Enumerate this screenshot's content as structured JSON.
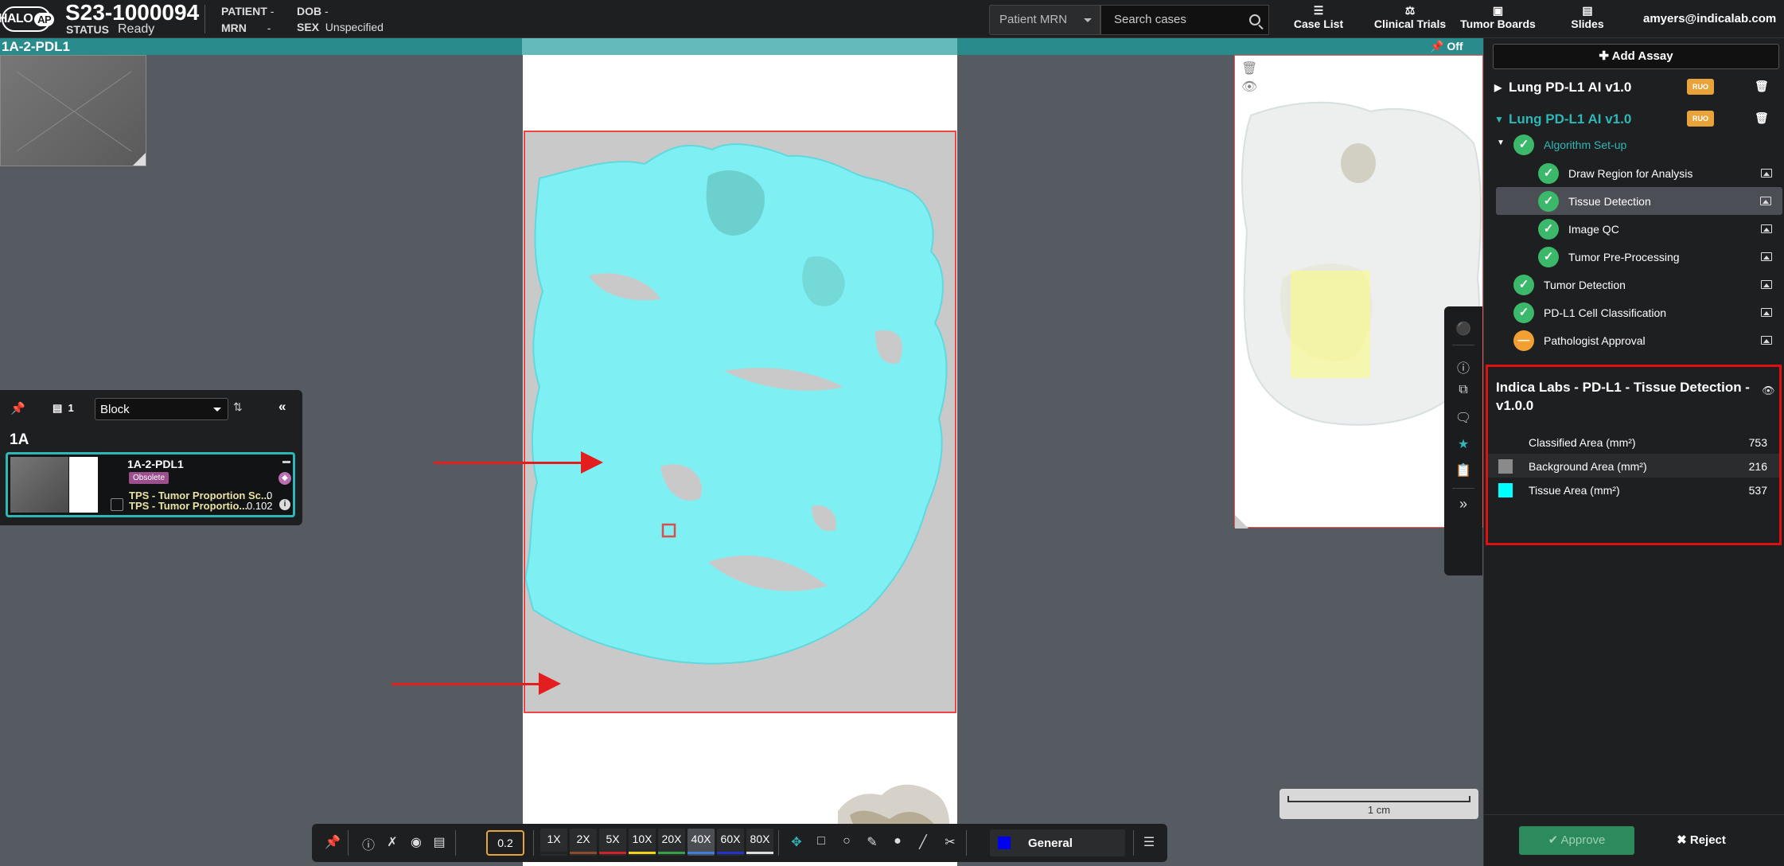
{
  "header": {
    "logo_text": "HALO",
    "logo_sub": "AP",
    "case_id": "S23-1000094",
    "status_label": "STATUS",
    "status_value": "Ready",
    "patient_label": "PATIENT",
    "patient_value": "-",
    "mrn_label": "MRN",
    "mrn_value": "-",
    "dob_label": "DOB",
    "dob_value": "-",
    "sex_label": "SEX",
    "sex_value": "Unspecified",
    "search_type": "Patient MRN",
    "search_placeholder": "Search cases",
    "nav": [
      {
        "label": "Case List",
        "icon": "list-icon"
      },
      {
        "label": "Clinical Trials",
        "icon": "flask-icon"
      },
      {
        "label": "Tumor Boards",
        "icon": "board-icon"
      },
      {
        "label": "Slides",
        "icon": "slides-icon"
      }
    ],
    "user": "amyers@indicalab.com"
  },
  "viewer": {
    "slide_title": "1A-2-PDL1",
    "toggle_label": "Off",
    "scale_label": "1 cm"
  },
  "slide_panel": {
    "count": "1",
    "group_by": "Block",
    "block_label": "1A",
    "slide": {
      "name": "1A-2-PDL1",
      "badge": "Obsolete",
      "metrics": [
        {
          "label": "TPS - Tumor Proportion Sc...",
          "value": "0"
        },
        {
          "label": "TPS - Tumor Proportio...",
          "value": "0.102"
        }
      ]
    }
  },
  "toolbar": {
    "value": "0.2",
    "zooms": [
      {
        "label": "1X",
        "color": "#222222"
      },
      {
        "label": "2X",
        "color": "#8b4a2b"
      },
      {
        "label": "5X",
        "color": "#d0202a"
      },
      {
        "label": "10X",
        "color": "#f2d21a"
      },
      {
        "label": "20X",
        "color": "#35a048"
      },
      {
        "label": "40X",
        "color": "#3c7fd6"
      },
      {
        "label": "60X",
        "color": "#2233cc"
      },
      {
        "label": "80X",
        "color": "#dddddd"
      }
    ],
    "selected_zoom": "40X",
    "class_name": "General",
    "class_color": "#0000ee"
  },
  "assays": {
    "add_label": "Add Assay",
    "items": [
      {
        "name": "Lung PD-L1 AI v1.0",
        "badge": "RUO",
        "expanded": false,
        "color": "#ffffff"
      },
      {
        "name": "Lung PD-L1 AI v1.0",
        "badge": "RUO",
        "expanded": true,
        "color": "#2fb7b7"
      }
    ],
    "steps": [
      {
        "label": "Algorithm Set-up",
        "state": "done",
        "level": 0,
        "group": true
      },
      {
        "label": "Draw Region for Analysis",
        "state": "done",
        "level": 1
      },
      {
        "label": "Tissue Detection",
        "state": "done",
        "level": 1,
        "selected": true
      },
      {
        "label": "Image QC",
        "state": "done",
        "level": 1
      },
      {
        "label": "Tumor Pre-Processing",
        "state": "done",
        "level": 1
      },
      {
        "label": "Tumor Detection",
        "state": "done",
        "level": 0
      },
      {
        "label": "PD-L1 Cell Classification",
        "state": "done",
        "level": 0
      },
      {
        "label": "Pathologist Approval",
        "state": "pending",
        "level": 0
      }
    ]
  },
  "results": {
    "title": "Indica Labs - PD-L1 - Tissue Detection - v1.0.0",
    "rows": [
      {
        "label": "Classified Area (mm²)",
        "value": "753",
        "color": ""
      },
      {
        "label": "Background Area (mm²)",
        "value": "216",
        "color": "#8a8a8a"
      },
      {
        "label": "Tissue Area (mm²)",
        "value": "537",
        "color": "#00ffff"
      }
    ]
  },
  "actions": {
    "approve": "Approve",
    "reject": "Reject"
  }
}
